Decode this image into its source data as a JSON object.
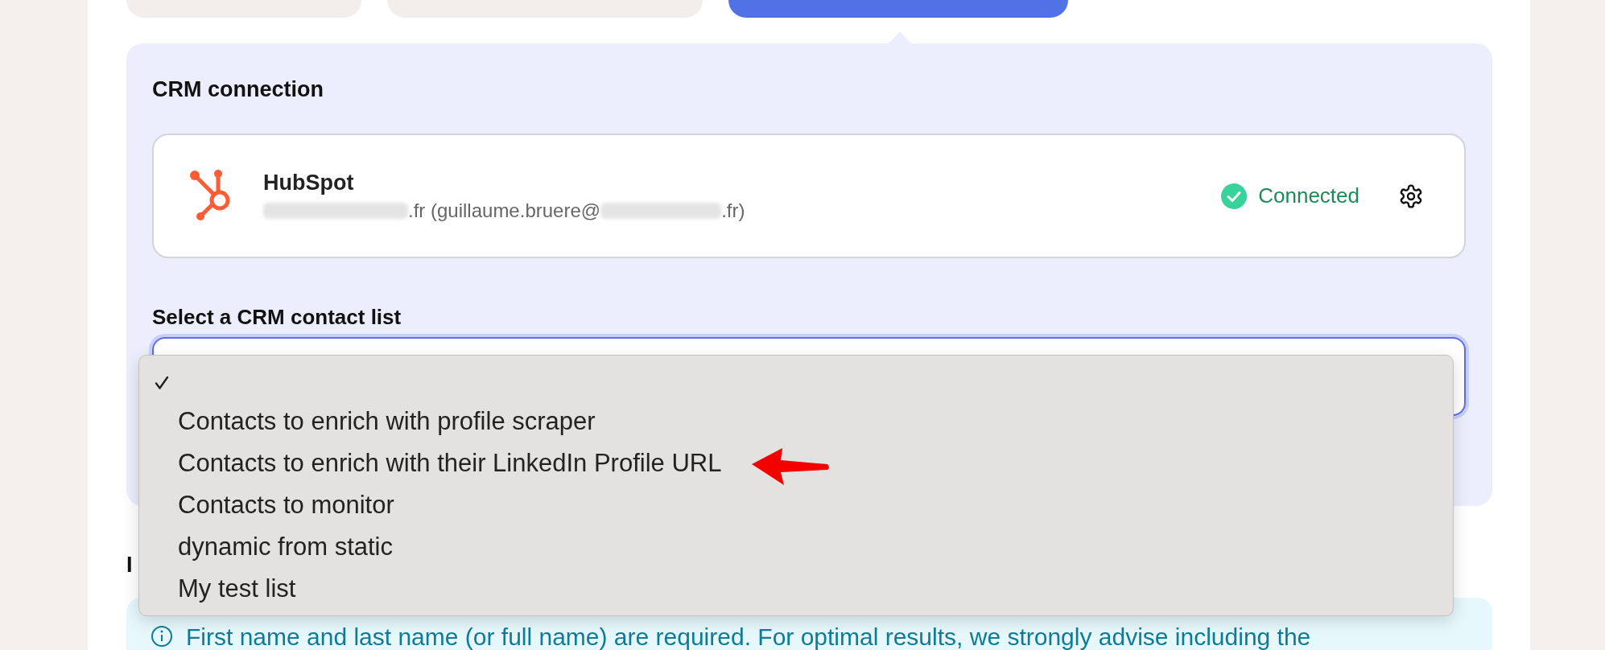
{
  "tabs": [
    {
      "selected": false
    },
    {
      "selected": false
    },
    {
      "selected": true
    }
  ],
  "crm_connection": {
    "title": "CRM connection",
    "account": {
      "name": "HubSpot",
      "detail": ".fr (guillaume.bruere@",
      "detail_end": ".fr)",
      "status": "Connected",
      "connected": true
    }
  },
  "contact_list": {
    "label": "Select a CRM contact list",
    "options": [
      {
        "selected": true
      },
      {
        "label": "Contacts to enrich with profile scraper",
        "selected": false
      },
      {
        "label": "Contacts to enrich with their LinkedIn Profile URL",
        "selected": false
      },
      {
        "label": "Contacts to monitor",
        "selected": false
      },
      {
        "label": "dynamic from static",
        "selected": false
      },
      {
        "label": "My test list",
        "selected": false
      }
    ]
  },
  "next_section": {
    "title": "I",
    "info": "First name and last name (or full name) are required. For optimal results, we strongly advise including the"
  }
}
